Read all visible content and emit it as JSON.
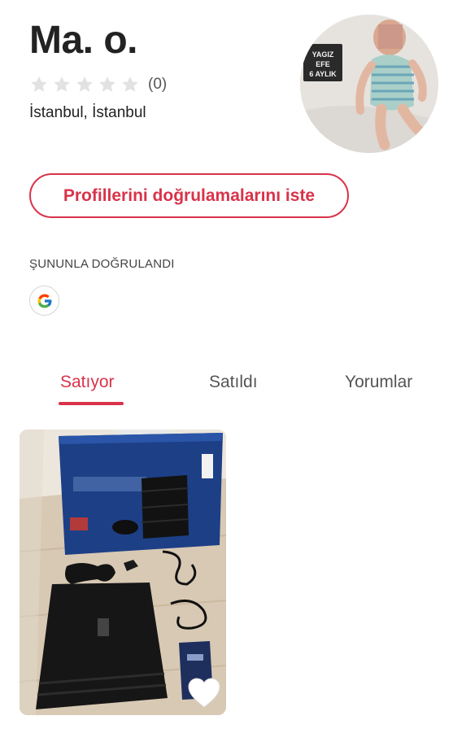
{
  "profile": {
    "name": "Ma. o.",
    "rating_stars": 0,
    "rating_max": 5,
    "rating_count": "(0)",
    "location": "İstanbul, İstanbul",
    "avatar_sign_text": [
      "YAGIZ",
      "EFE",
      "6 AYLIK"
    ]
  },
  "actions": {
    "verify_request_label": "Profillerini doğrulamalarını iste"
  },
  "verification": {
    "title": "ŞUNUNLA DOĞRULANDI",
    "providers": [
      {
        "icon": "google-icon"
      }
    ]
  },
  "tabs": [
    {
      "label": "Satıyor",
      "active": true
    },
    {
      "label": "Satıldı",
      "active": false
    },
    {
      "label": "Yorumlar",
      "active": false
    }
  ],
  "listings": [
    {
      "image": "ps4-pro-box-photo",
      "favorite_icon": "heart-icon",
      "favorited": false
    }
  ],
  "colors": {
    "accent": "#d8334a",
    "star_empty": "#e2e2e2",
    "text_primary": "#222222",
    "text_secondary": "#555555"
  }
}
